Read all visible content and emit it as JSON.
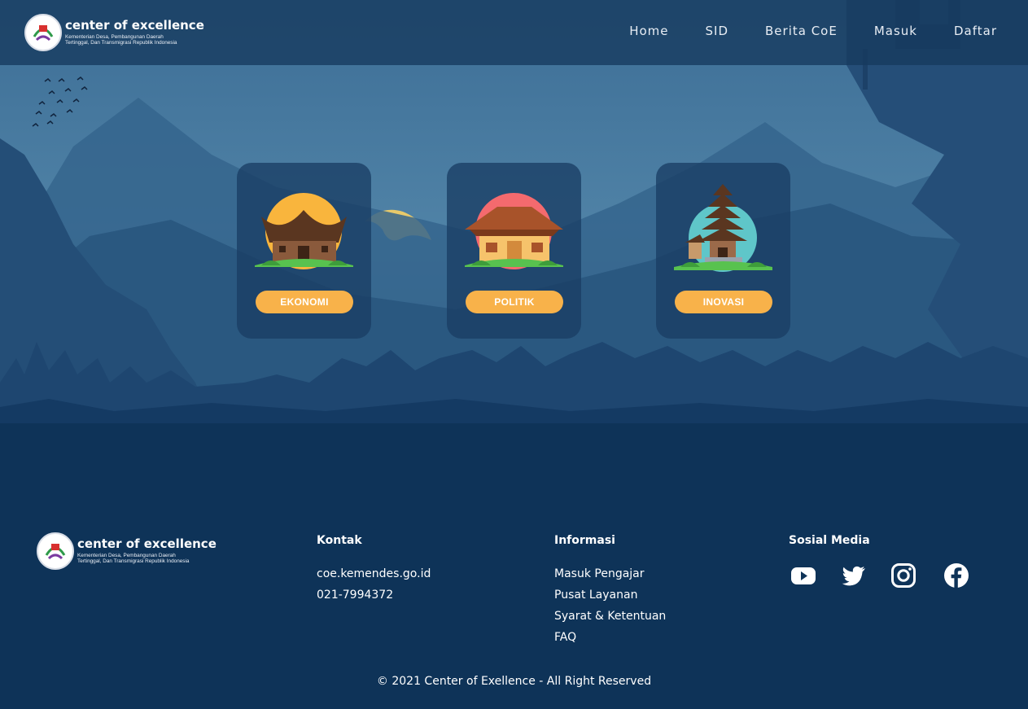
{
  "header": {
    "brand_title": "center of excellence",
    "brand_subtitle": "Kementerian Desa, Pembangunan Daerah Tertinggal, Dan Transmigrasi Republik Indonesia",
    "nav": [
      "Home",
      "SID",
      "Berita CoE",
      "Masuk",
      "Daftar"
    ]
  },
  "cards": [
    {
      "label": "EKONOMI",
      "icon": "rumah-gadang-icon",
      "sun_color": "#f9b53d"
    },
    {
      "label": "POLITIK",
      "icon": "joglo-house-icon",
      "sun_color": "#f46a6e"
    },
    {
      "label": "INOVASI",
      "icon": "pagoda-temple-icon",
      "sun_color": "#5fc6c9"
    }
  ],
  "footer": {
    "brand_title": "center of excellence",
    "brand_subtitle": "Kementerian Desa, Pembangunan Daerah Tertinggal, Dan Transmigrasi Republik Indonesia",
    "kontak": {
      "heading": "Kontak",
      "items": [
        "coe.kemendes.go.id",
        "021-7994372"
      ]
    },
    "informasi": {
      "heading": "Informasi",
      "items": [
        "Masuk Pengajar",
        "Pusat Layanan",
        "Syarat & Ketentuan",
        "FAQ"
      ]
    },
    "sosial": {
      "heading": "Sosial Media",
      "icons": [
        "youtube-icon",
        "twitter-icon",
        "instagram-icon",
        "facebook-icon"
      ]
    },
    "copyright": "© 2021 Center of Exellence - All Right Reserved"
  },
  "colors": {
    "background": "#0e3358",
    "navbar": "#163a5e",
    "button": "#f8b24a",
    "moon": "#e8c96a"
  }
}
